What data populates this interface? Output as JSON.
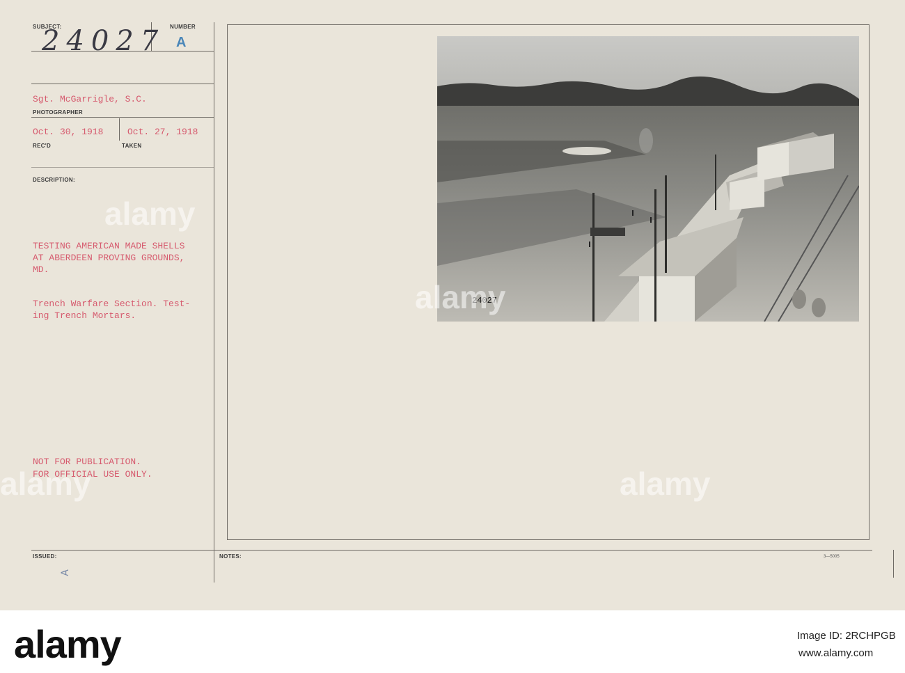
{
  "card": {
    "labels": {
      "subject": "SUBJECT:",
      "number": "NUMBER",
      "photographer": "PHOTOGRAPHER",
      "recd": "REC'D",
      "taken": "TAKEN",
      "description": "DESCRIPTION:",
      "issued": "ISSUED:",
      "notes": "NOTES:"
    },
    "subject_number": "24027",
    "number_value": "A",
    "photographer_name": "Sgt. McGarrigle, S.C.",
    "recd_date": "Oct. 30, 1918",
    "taken_date": "Oct. 27, 1918",
    "description_lines": [
      "TESTING AMERICAN MADE SHELLS",
      "AT ABERDEEN PROVING GROUNDS,",
      "MD."
    ],
    "detail_lines": [
      "Trench Warfare Section. Test-",
      "ing Trench Mortars."
    ],
    "restriction_lines": [
      "NOT FOR PUBLICATION.",
      "FOR OFFICIAL USE ONLY."
    ],
    "issued_mark": "A",
    "form_code": "3—5005",
    "photo_number": "24027"
  },
  "watermark_text": "alamy",
  "footer": {
    "logo": "alamy",
    "image_id": "Image ID: 2RCHPGB",
    "site": "www.alamy.com"
  }
}
